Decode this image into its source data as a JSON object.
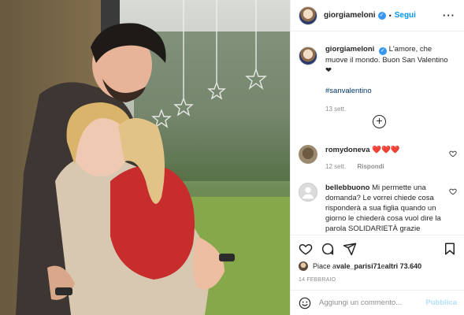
{
  "header": {
    "username": "giorgiameloni",
    "separator": "•",
    "follow_label": "Segui",
    "more": "···"
  },
  "caption": {
    "username": "giorgiameloni",
    "text": "L'amore, che muove il mondo. Buon San Valentino ❤",
    "hashtag": "#sanvalentino",
    "time": "13 sett."
  },
  "comments": [
    {
      "username": "romydoneva",
      "text": "❤️❤️❤️",
      "time": "12 sett.",
      "reply_label": "Rispondi"
    },
    {
      "username": "bellebbuono",
      "text": "Mi permette una domanda? Le vorrei chiede cosa risponderà a sua figlia quando un giorno le chiederà cosa vuol dire la parola SOLIDARIETÀ grazie"
    }
  ],
  "likes": {
    "prefix": "Piace a ",
    "user": "vale_parisi71",
    "middle": " e ",
    "others": "altri 73.640"
  },
  "post_date": "14 FEBBRAIO",
  "add_comment": {
    "placeholder": "Aggiungi un commento...",
    "post_label": "Pubblica"
  },
  "colors": {
    "accent": "#0095f6",
    "verified": "#3897f0",
    "muted": "#8e8e8e"
  }
}
